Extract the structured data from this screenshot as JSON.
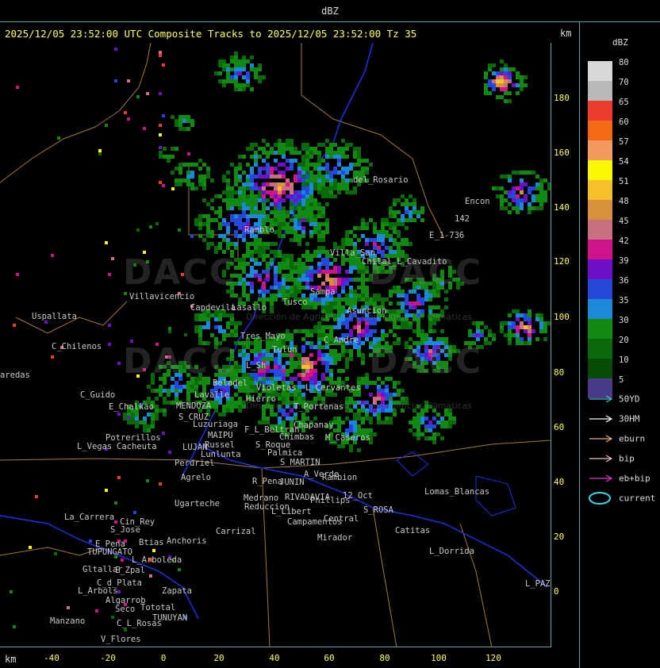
{
  "header": {
    "product": "dBZ",
    "title": "2025/12/05 23:52:00 UTC Composite Tracks to 2025/12/05 23:52:00 Tz 35",
    "unit_top": "km",
    "unit_bottom": "km"
  },
  "axes": {
    "y_ticks": [
      "180",
      "160",
      "140",
      "120",
      "100",
      "80",
      "60",
      "40",
      "20",
      "0"
    ],
    "x_ticks": [
      "-40",
      "-20",
      "0",
      "20",
      "40",
      "60",
      "80",
      "100",
      "120"
    ]
  },
  "legend": {
    "title": "dBZ",
    "scale": [
      {
        "value": "80",
        "color": "#d8d8d8"
      },
      {
        "value": "70",
        "color": "#b8b8b8"
      },
      {
        "value": "65",
        "color": "#ee3c2c"
      },
      {
        "value": "60",
        "color": "#f46a14"
      },
      {
        "value": "57",
        "color": "#f49a60"
      },
      {
        "value": "54",
        "color": "#f8f800"
      },
      {
        "value": "51",
        "color": "#f6c02c"
      },
      {
        "value": "48",
        "color": "#d8903c"
      },
      {
        "value": "45",
        "color": "#c87080"
      },
      {
        "value": "42",
        "color": "#d0128c"
      },
      {
        "value": "39",
        "color": "#6e10c8"
      },
      {
        "value": "36",
        "color": "#2448dc"
      },
      {
        "value": "35",
        "color": "#1c88d8"
      },
      {
        "value": "30",
        "color": "#108a10"
      },
      {
        "value": "20",
        "color": "#0a6a0a"
      },
      {
        "value": "10",
        "color": "#064c06"
      },
      {
        "value": "5",
        "color": "#4a3a8a"
      }
    ],
    "tracks": [
      {
        "label": "50YD",
        "color": "#3cc8c8",
        "kind": "arrow"
      },
      {
        "label": "30HM",
        "color": "#ffffff",
        "kind": "arrow"
      },
      {
        "label": "eburn",
        "color": "#e8b070",
        "kind": "arrow"
      },
      {
        "label": "bip",
        "color": "#f0c0c0",
        "kind": "arrow"
      },
      {
        "label": "eb+bip",
        "color": "#d040d0",
        "kind": "arrow"
      },
      {
        "label": "current",
        "color": "#3cd8e8",
        "kind": "ellipse"
      }
    ]
  },
  "watermark": {
    "text": "DACC",
    "subtitle": "Dirección de Agricultura y Contingencias Climáticas"
  },
  "places": [
    {
      "name": "del_Rosario",
      "x": 445,
      "y": 226
    },
    {
      "name": "Encon",
      "x": 586,
      "y": 253
    },
    {
      "name": "142",
      "x": 573,
      "y": 275
    },
    {
      "name": "E_1-736",
      "x": 541,
      "y": 296
    },
    {
      "name": "Ramblo",
      "x": 308,
      "y": 289
    },
    {
      "name": "Villa_San",
      "x": 416,
      "y": 318
    },
    {
      "name": "Chilal_L_Cavadito",
      "x": 456,
      "y": 329
    },
    {
      "name": "Villavicencio",
      "x": 163,
      "y": 373
    },
    {
      "name": "Capdevila",
      "x": 240,
      "y": 387
    },
    {
      "name": "Lasallo",
      "x": 292,
      "y": 387
    },
    {
      "name": "Tusco",
      "x": 356,
      "y": 380
    },
    {
      "name": "Sampa",
      "x": 391,
      "y": 367
    },
    {
      "name": "Asuncion",
      "x": 437,
      "y": 391
    },
    {
      "name": "Uspallata",
      "x": 40,
      "y": 398
    },
    {
      "name": "Tres_Mayo",
      "x": 303,
      "y": 423
    },
    {
      "name": "C_Andre",
      "x": 408,
      "y": 428
    },
    {
      "name": "C_Chilenos",
      "x": 65,
      "y": 436
    },
    {
      "name": "Tulun",
      "x": 343,
      "y": 440
    },
    {
      "name": "aredas",
      "x": 0,
      "y": 472
    },
    {
      "name": "L_Sh",
      "x": 310,
      "y": 460
    },
    {
      "name": "Beladel",
      "x": 268,
      "y": 482
    },
    {
      "name": "Violetas",
      "x": 323,
      "y": 488
    },
    {
      "name": "L_Cervantes",
      "x": 385,
      "y": 488
    },
    {
      "name": "C_Guido",
      "x": 101,
      "y": 497
    },
    {
      "name": "Lavalle",
      "x": 245,
      "y": 497
    },
    {
      "name": "Hierro",
      "x": 310,
      "y": 502
    },
    {
      "name": "E_Chalkao",
      "x": 137,
      "y": 512
    },
    {
      "name": "MENDOZA",
      "x": 222,
      "y": 511
    },
    {
      "name": "T_Portenas",
      "x": 370,
      "y": 512
    },
    {
      "name": "S_CRUZ",
      "x": 225,
      "y": 525
    },
    {
      "name": "Luzuriaga",
      "x": 243,
      "y": 534
    },
    {
      "name": "Chapanay",
      "x": 370,
      "y": 535
    },
    {
      "name": "F_L_Beltran",
      "x": 308,
      "y": 541
    },
    {
      "name": "MAIPU",
      "x": 262,
      "y": 548
    },
    {
      "name": "Chimbas",
      "x": 352,
      "y": 550
    },
    {
      "name": "M_Caseros",
      "x": 410,
      "y": 551
    },
    {
      "name": "Potrerillos",
      "x": 133,
      "y": 551
    },
    {
      "name": "L_Vegas",
      "x": 97,
      "y": 562
    },
    {
      "name": "Cacheuta",
      "x": 147,
      "y": 562
    },
    {
      "name": "Russel",
      "x": 258,
      "y": 560
    },
    {
      "name": "S_Roque",
      "x": 322,
      "y": 560
    },
    {
      "name": "LUJAN",
      "x": 230,
      "y": 563
    },
    {
      "name": "Lunlunta",
      "x": 253,
      "y": 572
    },
    {
      "name": "Palmica",
      "x": 337,
      "y": 570
    },
    {
      "name": "Perdriel",
      "x": 220,
      "y": 583
    },
    {
      "name": "S_MARTIN",
      "x": 353,
      "y": 582
    },
    {
      "name": "A_Verde",
      "x": 383,
      "y": 597
    },
    {
      "name": "Rambion",
      "x": 406,
      "y": 601
    },
    {
      "name": "Agrelo",
      "x": 228,
      "y": 601
    },
    {
      "name": "R_Pena",
      "x": 318,
      "y": 606
    },
    {
      "name": "JUNIN",
      "x": 352,
      "y": 607
    },
    {
      "name": "Lomas_Blancas",
      "x": 535,
      "y": 619
    },
    {
      "name": "12_Oct",
      "x": 432,
      "y": 624
    },
    {
      "name": "Medrano",
      "x": 307,
      "y": 627
    },
    {
      "name": "RIVADAVIA",
      "x": 359,
      "y": 626
    },
    {
      "name": "Phillips",
      "x": 391,
      "y": 630
    },
    {
      "name": "Ugarteche",
      "x": 220,
      "y": 634
    },
    {
      "name": "Reduccion",
      "x": 308,
      "y": 638
    },
    {
      "name": "S_ROSA",
      "x": 458,
      "y": 642
    },
    {
      "name": "L_Libert",
      "x": 342,
      "y": 644
    },
    {
      "name": "La_Carrera",
      "x": 81,
      "y": 651
    },
    {
      "name": "Cin_Rey",
      "x": 151,
      "y": 657
    },
    {
      "name": "Central",
      "x": 408,
      "y": 653
    },
    {
      "name": "Campamentos",
      "x": 362,
      "y": 657
    },
    {
      "name": "S_Jose",
      "x": 139,
      "y": 667
    },
    {
      "name": "Carrizal",
      "x": 272,
      "y": 669
    },
    {
      "name": "Catitas",
      "x": 498,
      "y": 668
    },
    {
      "name": "Mirador",
      "x": 400,
      "y": 677
    },
    {
      "name": "Anchoris",
      "x": 210,
      "y": 681
    },
    {
      "name": "E_Pena",
      "x": 120,
      "y": 685
    },
    {
      "name": "Btias",
      "x": 175,
      "y": 683
    },
    {
      "name": "TUPUNGATO",
      "x": 110,
      "y": 695
    },
    {
      "name": "L_Dorrida",
      "x": 541,
      "y": 694
    },
    {
      "name": "L_Arboleda",
      "x": 166,
      "y": 705
    },
    {
      "name": "Gltallar",
      "x": 104,
      "y": 717
    },
    {
      "name": "E_Zpal",
      "x": 145,
      "y": 718
    },
    {
      "name": "C_d_Plata",
      "x": 122,
      "y": 734
    },
    {
      "name": "L_PAZ",
      "x": 662,
      "y": 735
    },
    {
      "name": "L_Arbols",
      "x": 98,
      "y": 744
    },
    {
      "name": "Zapata",
      "x": 204,
      "y": 744
    },
    {
      "name": "Algarrob",
      "x": 133,
      "y": 756
    },
    {
      "name": "Seco",
      "x": 145,
      "y": 767
    },
    {
      "name": "Tototal",
      "x": 177,
      "y": 765
    },
    {
      "name": "TUNUYAN",
      "x": 192,
      "y": 778
    },
    {
      "name": "Manzano",
      "x": 63,
      "y": 782
    },
    {
      "name": "C_L_Rosas",
      "x": 147,
      "y": 785
    },
    {
      "name": "V_Flores",
      "x": 127,
      "y": 805
    }
  ]
}
